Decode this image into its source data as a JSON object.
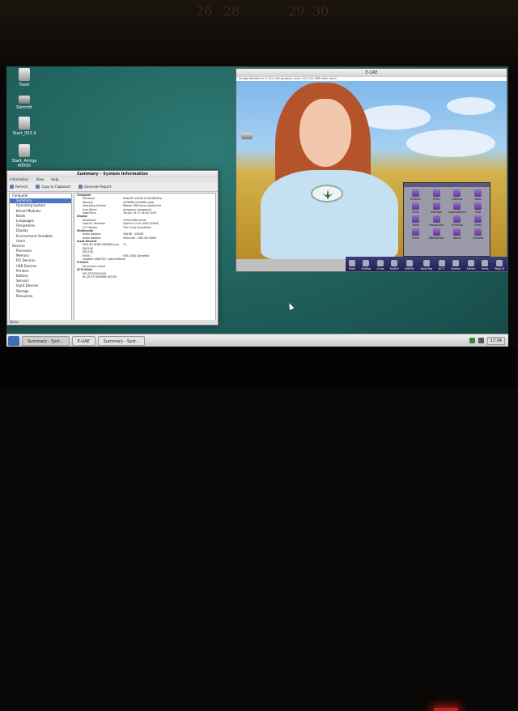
{
  "desktop": {
    "icons": [
      {
        "label": "Trash"
      },
      {
        "label": "Slemtitt"
      },
      {
        "label": "Start_053.9"
      },
      {
        "label": "Start_Amiga 4000D"
      }
    ]
  },
  "sysinfo": {
    "title": "Summary - System Information",
    "menu": [
      "Information",
      "View",
      "Help"
    ],
    "toolbar": {
      "refresh": "Refresh",
      "copy": "Copy to Clipboard",
      "report": "Generate Report"
    },
    "tree": [
      {
        "label": "Computer",
        "cat": true
      },
      {
        "label": "Summary",
        "selected": true
      },
      {
        "label": "Operating System"
      },
      {
        "label": "Kernel Modules"
      },
      {
        "label": "Boots"
      },
      {
        "label": "Languages"
      },
      {
        "label": "Filesystems"
      },
      {
        "label": "Display"
      },
      {
        "label": "Environment Variables"
      },
      {
        "label": "Users"
      },
      {
        "label": "Devices",
        "cat": true
      },
      {
        "label": "Processor"
      },
      {
        "label": "Memory"
      },
      {
        "label": "PCI Devices"
      },
      {
        "label": "USB Devices"
      },
      {
        "label": "Printers"
      },
      {
        "label": "Battery"
      },
      {
        "label": "Sensors"
      },
      {
        "label": "Input Devices"
      },
      {
        "label": "Storage"
      },
      {
        "label": "Resources"
      }
    ],
    "details": [
      {
        "section": "Computer"
      },
      {
        "k": "Processor",
        "v": "PowerPC e5500 (2199.89MHz)"
      },
      {
        "k": "Memory",
        "v": "4078MB (2229MB used)"
      },
      {
        "k": "Operating System",
        "v": "Debian GNU/Linux stretch/sid"
      },
      {
        "k": "User Name",
        "v": "amigaone (amigaone)"
      },
      {
        "k": "Date/Time",
        "v": "Tue Jan 19 17:34:00 2016"
      },
      {
        "section": "Display"
      },
      {
        "k": "Resolution",
        "v": "1920x1080 pixels"
      },
      {
        "k": "OpenGL Renderer",
        "v": "Gallium 0.4 on AMD CEDAR"
      },
      {
        "k": "X11 Vendor",
        "v": "The X.Org Foundation"
      },
      {
        "section": "Multimedia"
      },
      {
        "k": "Audio Adapter",
        "v": "VIAHDI - VIAHDI"
      },
      {
        "k": "Audio Adapter",
        "v": "HDA-Intel - HDA ATI HDMI"
      },
      {
        "section": "Input Devices"
      },
      {
        "k": "HDA ATI HDMI HDMI/DP,pcm",
        "v": "3="
      },
      {
        "k": "DK2108",
        "v": ""
      },
      {
        "k": "DK2108",
        "v": ""
      },
      {
        "k": "MOSIC",
        "v": "USB 2AXK   GameRoll"
      },
      {
        "k": "Logitech USB-PS/2 Optical Mouse",
        "v": ""
      },
      {
        "section": "Printers"
      },
      {
        "k": "No printers found",
        "v": ""
      },
      {
        "section": "SCSI Disks"
      },
      {
        "k": "ATA ST3320310AS",
        "v": ""
      },
      {
        "k": "HL-DT-ST DVDRAM GH22N",
        "v": ""
      }
    ],
    "status": "Done."
  },
  "euae": {
    "title": "E-UAE",
    "workbench_bar": "Amiga Workbench  2,321,160 graphics mem  142,123,396 other mem",
    "drawer_items": [
      "System",
      "Prefs",
      "Utilities",
      "Tools",
      "Devs",
      "Storage",
      "Applications",
      "CD0",
      "Tools",
      "Expansion",
      "Pictures",
      "Fonts",
      "Prefs",
      "WBStartup",
      "Rexxc",
      "Classes"
    ],
    "dock": [
      "Shell",
      "EdiPad",
      "Lines",
      "MultiV",
      "AMIPIC",
      "DeskTop",
      "ACT!",
      "Games",
      "Amien",
      "Prefs",
      "PlayCD"
    ]
  },
  "taskbar": {
    "buttons": [
      "Summary - Syst...",
      "E-UAE",
      "Summary - Syst..."
    ],
    "clock": "17:34"
  },
  "wall_numbers": [
    "26",
    "28",
    "29",
    "30"
  ],
  "colors": {
    "desktop": "#1f5f5b",
    "selection": "#4a78c8"
  }
}
